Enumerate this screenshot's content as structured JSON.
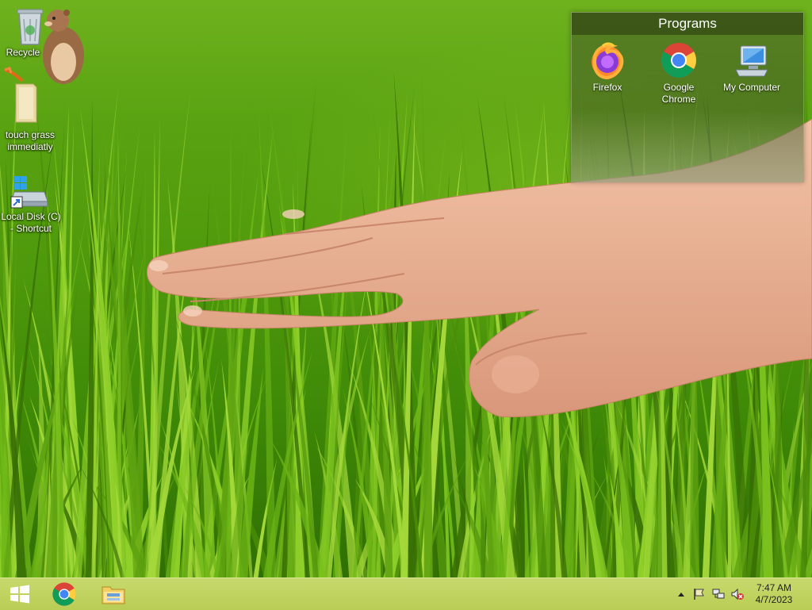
{
  "desktop": {
    "icons": [
      {
        "label": "Recycle"
      },
      {
        "label": "touch grass immediatly"
      },
      {
        "label": "Local Disk (C) - Shortcut"
      }
    ]
  },
  "programs": {
    "title": "Programs",
    "items": [
      {
        "label": "Firefox",
        "icon": "firefox-icon"
      },
      {
        "label": "Google Chrome",
        "icon": "chrome-icon"
      },
      {
        "label": "My Computer",
        "icon": "computer-icon"
      }
    ]
  },
  "taskbar": {
    "pinned": [
      {
        "icon": "windows-logo-icon"
      },
      {
        "icon": "chrome-icon"
      },
      {
        "icon": "file-explorer-icon"
      }
    ],
    "tray_icons": [
      "show-hidden-icons",
      "action-center-flag-icon",
      "network-icon",
      "volume-muted-icon"
    ],
    "clock": {
      "time": "7:47 AM",
      "date": "4/7/2023"
    }
  },
  "colors": {
    "taskbar": "#bfd25c",
    "grass": "#5aa312"
  }
}
